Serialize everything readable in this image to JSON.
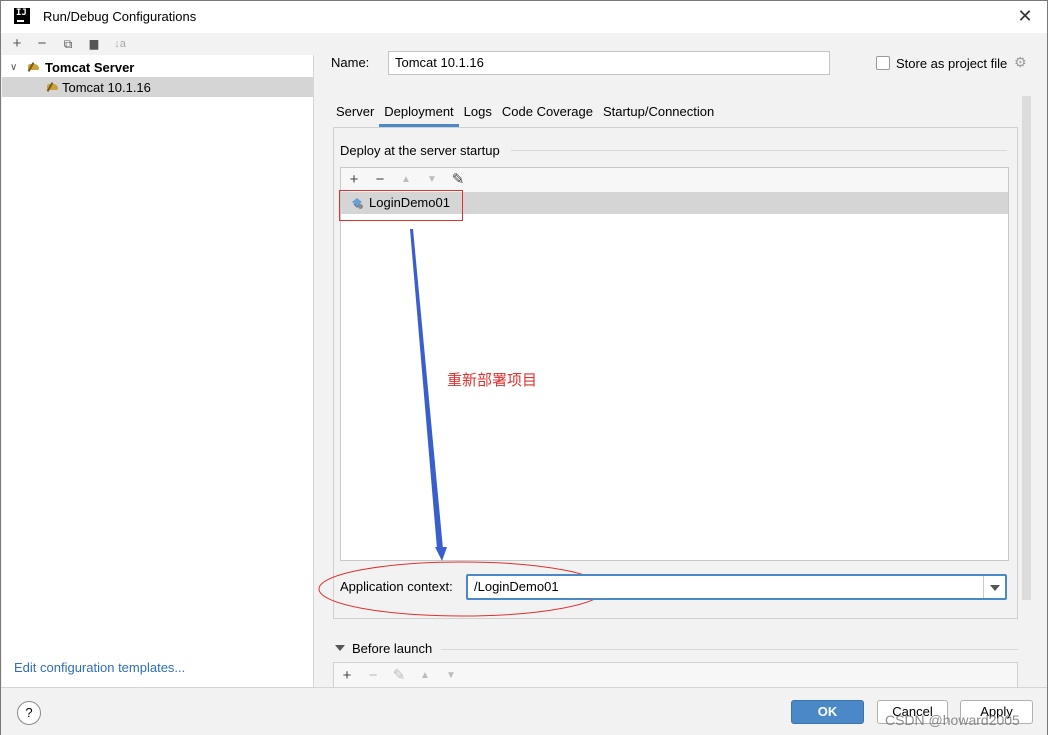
{
  "window": {
    "title": "Run/Debug Configurations",
    "app_icon_text": "IJ"
  },
  "left_toolbar": {
    "add": "+",
    "remove": "−",
    "copy": "⧉",
    "folder": "▆",
    "sort": "↓a"
  },
  "tree": {
    "group_label": "Tomcat Server",
    "item_label": "Tomcat 10.1.16"
  },
  "left_footer": {
    "edit_templates": "Edit configuration templates..."
  },
  "name_field": {
    "label": "Name:",
    "value": "Tomcat 10.1.16"
  },
  "store_as_project": {
    "label": "Store as project file",
    "checked": false
  },
  "tabs": [
    {
      "label": "Server"
    },
    {
      "label": "Deployment"
    },
    {
      "label": "Logs"
    },
    {
      "label": "Code Coverage"
    },
    {
      "label": "Startup/Connection"
    }
  ],
  "deployment": {
    "section_title": "Deploy at the server startup",
    "toolbar": {
      "add": "+",
      "remove": "−",
      "up": "▲",
      "down": "▼",
      "edit": "✎"
    },
    "artifact": "LoginDemo01"
  },
  "annotation": {
    "text": "重新部署项目",
    "color": "#e03030"
  },
  "app_context": {
    "label": "Application context:",
    "value": "/LoginDemo01"
  },
  "before_launch": {
    "label": "Before launch",
    "toolbar": {
      "add": "+",
      "remove": "−",
      "edit": "✎",
      "up": "▲",
      "down": "▼"
    }
  },
  "buttons": {
    "help": "?",
    "ok": "OK",
    "cancel": "Cancel",
    "apply": "Apply"
  },
  "watermark": "CSDN @howard2005",
  "colors": {
    "accent": "#4a88c7",
    "selection": "#d5d5d5",
    "annotation_red": "#e03030",
    "arrow_blue": "#3a5fcd"
  }
}
